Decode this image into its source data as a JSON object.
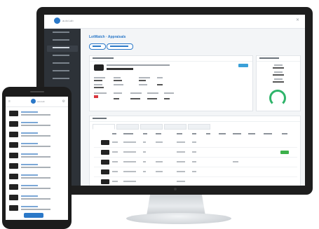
{
  "monitor": {
    "brand": "autoLab",
    "page_title": "LotWatch  ·  Appraisals",
    "toolbar": {
      "btn1": "",
      "btn2": ""
    },
    "summary_title": "",
    "side_panel_title": "",
    "tabs_title": ""
  },
  "phone": {
    "brand": "autoLab",
    "menu_icon": "menu-icon",
    "settings_icon": "gear-icon",
    "action_label": ""
  },
  "colors": {
    "accent": "#2a78c8",
    "sidebar": "#2d3238",
    "success": "#3cb04a",
    "alert": "#d9363e"
  }
}
